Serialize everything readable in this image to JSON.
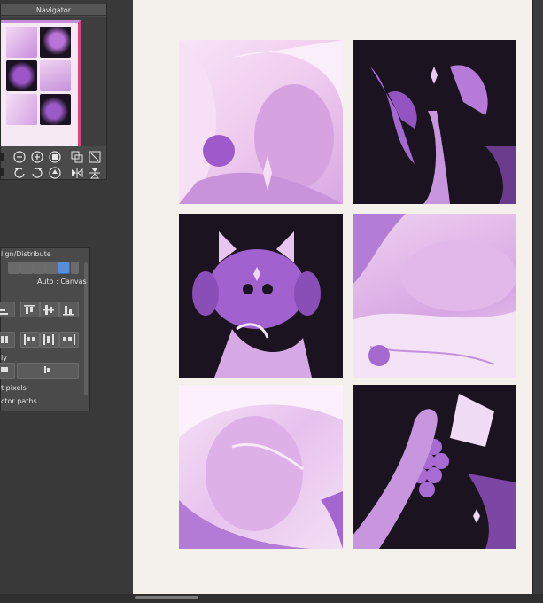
{
  "navigator": {
    "title": "Navigator",
    "tools_row1": [
      "square-icon",
      "zoom-out-icon",
      "zoom-in-icon",
      "record-icon",
      "fit-icon",
      "expand-icon"
    ],
    "tools_row2": [
      "square-icon",
      "rotate-left-icon",
      "rotate-right-icon",
      "reset-rotation-icon",
      "flip-horizontal-icon",
      "flip-vertical-icon"
    ]
  },
  "align": {
    "title": "lign/Distribute",
    "target_label": "Auto : Canvas",
    "only_label": "ly",
    "pixels_label": "t pixels",
    "vector_label": "ctor paths"
  },
  "colors": {
    "accent_pink": "#d9467e",
    "lilac_light": "#efd0f0",
    "purple": "#9b56c9",
    "dark": "#1b1320"
  }
}
